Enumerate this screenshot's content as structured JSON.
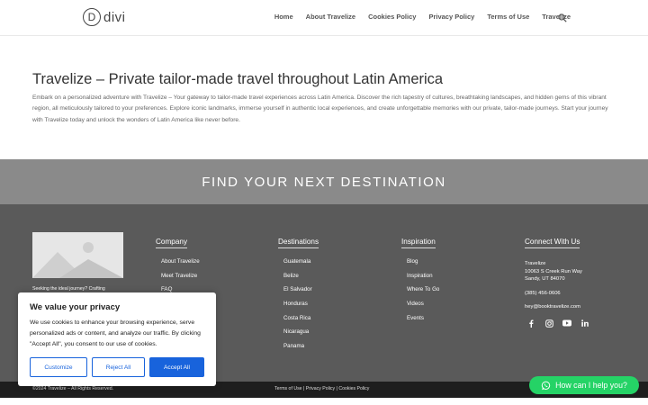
{
  "header": {
    "logo_letter": "D",
    "logo_text": "divi",
    "nav": [
      "Home",
      "About Travelize",
      "Cookies Policy",
      "Privacy Policy",
      "Terms of Use",
      "Travelize"
    ]
  },
  "intro": {
    "title": "Travelize – Private tailor-made travel throughout Latin America",
    "body": "Embark on a personalized adventure with Travelize – Your gateway to tailor-made travel experiences across Latin America. Discover the rich tapestry of cultures, breathtaking landscapes, and hidden gems of this vibrant region, all meticulously tailored to your preferences. Explore iconic landmarks, immerse yourself in authentic local experiences, and create unforgettable memories with our private, tailor-made journeys. Start your journey with Travelize today and unlock the wonders of Latin America like never before."
  },
  "banner": {
    "text": "FIND YOUR NEXT DESTINATION"
  },
  "footer": {
    "tagline": "Seeking the ideal journey? Crafting",
    "company": {
      "title": "Company",
      "items": [
        "About Travelize",
        "Meet Travelize",
        "FAQ"
      ]
    },
    "destinations": {
      "title": "Destinations",
      "items": [
        "Guatemala",
        "Belize",
        "El Salvador",
        "Honduras",
        "Costa Rica",
        "Nicaragua",
        "Panama"
      ]
    },
    "inspiration": {
      "title": "Inspiration",
      "items": [
        "Blog",
        "Inspiration",
        "Where To Go",
        "Videos",
        "Events"
      ]
    },
    "connect": {
      "title": "Connect With Us",
      "name": "Travelize",
      "address1": "10063 S Creek Run Way",
      "address2": "Sandy, UT 84070",
      "phone": "(385) 456-0606",
      "email": "hey@booktravelize.com"
    },
    "socials": [
      "facebook-icon",
      "instagram-icon",
      "youtube-icon",
      "linkedin-icon"
    ]
  },
  "bottom": {
    "copyright": "©2024 Travelize – All Rights Reserved.",
    "terms": "Terms of Use",
    "sep1": " | ",
    "privacy": "Privacy Policy",
    "sep2": " | ",
    "cookies": "Cookies Policy"
  },
  "cookie": {
    "title": "We value your privacy",
    "body": "We use cookies to enhance your browsing experience, serve personalized ads or content, and analyze our traffic. By clicking \"Accept All\", you consent to our use of cookies.",
    "customize": "Customize",
    "reject": "Reject All",
    "accept": "Accept All"
  },
  "whatsapp": {
    "label": "How can I help you?"
  },
  "colors": {
    "accent": "#1863dc",
    "whatsapp": "#25d366",
    "footer_bg": "#5a5a5a",
    "banner_bg": "#8a8a8a"
  }
}
